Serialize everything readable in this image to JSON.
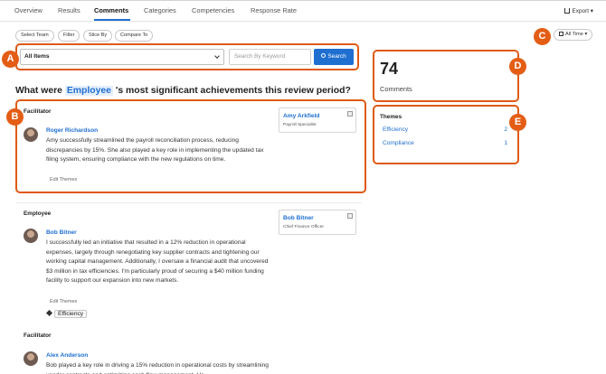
{
  "tabs": [
    {
      "label": "Overview"
    },
    {
      "label": "Results"
    },
    {
      "label": "Comments"
    },
    {
      "label": "Categories"
    },
    {
      "label": "Competencies"
    },
    {
      "label": "Response Rate"
    }
  ],
  "export_label": "Export",
  "filters": {
    "select_team": "Select Team",
    "filter": "Filter",
    "slice_by": "Slice By",
    "compare_to": "Compare To",
    "all_time": "All Time"
  },
  "search": {
    "select_value": "All Items",
    "keyword_placeholder": "Search By Keyword",
    "button_label": "Search"
  },
  "question": {
    "prefix": "What were",
    "highlight": "Employee",
    "suffix": "'s most significant achievements this review period?"
  },
  "comments": [
    {
      "role": "Facilitator",
      "author": "Roger Richardson",
      "text": "Amy successfully streamlined the payroll reconciliation process, reducing discrepancies by 15%. She also played a key role in implementing the updated tax filing system, ensuring compliance with the new regulations on time.",
      "edit_label": "Edit Themes",
      "subject_name": "Amy Arkfield",
      "subject_title": "Payroll Specialist"
    },
    {
      "role": "Employee",
      "author": "Bob Bitner",
      "text": "I successfully led an initiative that resulted in a 12% reduction in operational expenses, largely through renegotiating key supplier contracts and tightening our working capital management. Additionally, I oversaw a financial audit that uncovered $3 million in tax efficiencies. I'm particularly proud of securing a $40 million funding facility to support our expansion into new markets.",
      "edit_label": "Edit Themes",
      "subject_name": "Bob Bitner",
      "subject_title": "Chief Finance Officer",
      "tag": "Efficiency"
    },
    {
      "role": "Facilitator",
      "author": "Alex Anderson",
      "text": "Bob played a key role in driving a 15% reduction in operational costs by streamlining vendor contracts and optimizing cash flow management. He"
    }
  ],
  "summary": {
    "count": "74",
    "count_label": "Comments",
    "themes_title": "Themes",
    "themes": [
      {
        "label": "Efficiency",
        "count": "2"
      },
      {
        "label": "Compliance",
        "count": "1"
      }
    ]
  },
  "callouts": {
    "a": "A",
    "b": "B",
    "c": "C",
    "d": "D",
    "e": "E"
  },
  "colors": {
    "accent": "#1f6fd1",
    "callout": "#e45d15"
  }
}
